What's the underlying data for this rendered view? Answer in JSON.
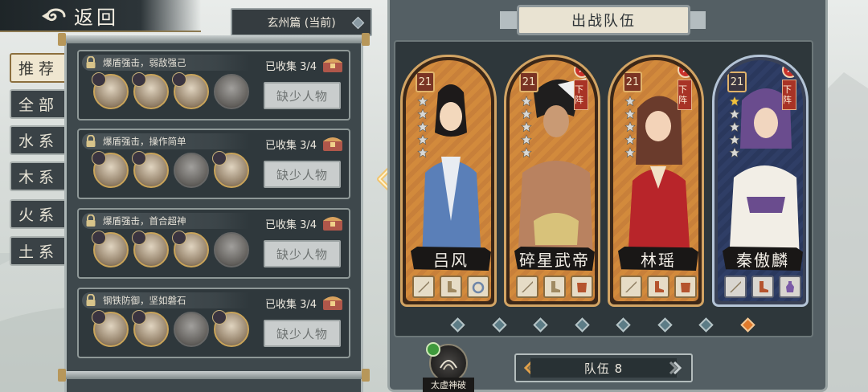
{
  "header": {
    "back_label": "返回",
    "chapter_label": "玄州篇 (当前)"
  },
  "tabs": [
    {
      "label": "推荐",
      "active": true
    },
    {
      "label": "全部",
      "active": false
    },
    {
      "label": "水系",
      "active": false
    },
    {
      "label": "木系",
      "active": false
    },
    {
      "label": "火系",
      "active": false
    },
    {
      "label": "土系",
      "active": false
    }
  ],
  "recommendations": [
    {
      "desc": "爆盾强击，弱敌强己",
      "collected": "已收集 3/4",
      "missing_label": "缺少人物"
    },
    {
      "desc": "爆盾强击，操作简单",
      "collected": "已收集 3/4",
      "missing_label": "缺少人物"
    },
    {
      "desc": "爆盾强击，首合超神",
      "collected": "已收集 3/4",
      "missing_label": "缺少人物"
    },
    {
      "desc": "钢铁防御，坚如磐石",
      "collected": "已收集 3/4",
      "missing_label": "缺少人物"
    }
  ],
  "team": {
    "title": "出战队伍",
    "remove_tag": "下阵",
    "members": [
      {
        "name": "吕风",
        "level": "21",
        "stars_filled": 0,
        "removable": false,
        "theme": "orange"
      },
      {
        "name": "碎星武帝",
        "level": "21",
        "stars_filled": 0,
        "removable": true,
        "theme": "orange"
      },
      {
        "name": "林瑶",
        "level": "21",
        "stars_filled": 0,
        "removable": true,
        "theme": "orange"
      },
      {
        "name": "秦傲麟",
        "level": "21",
        "stars_filled": 1,
        "removable": true,
        "theme": "blue"
      }
    ],
    "page_count": 8,
    "active_page": 8,
    "team_label": "队伍 8"
  },
  "skill": {
    "label": "太虚神破"
  },
  "colors": {
    "accent_orange": "#e07a2c",
    "remove_red": "#c9322a",
    "card_border_gold": "#d2a464"
  }
}
